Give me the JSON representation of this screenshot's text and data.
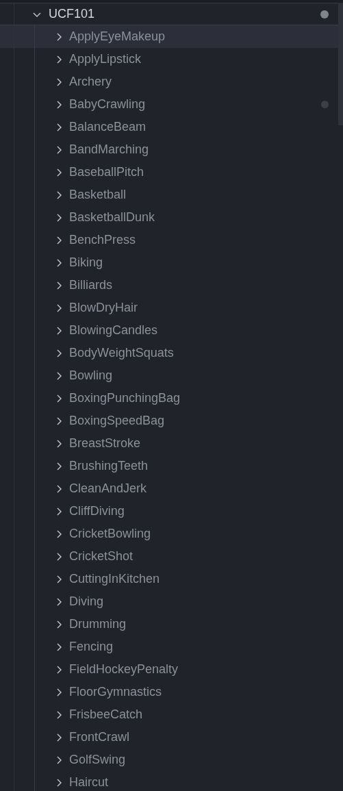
{
  "tree": {
    "label": "UCF101",
    "expanded": true,
    "modified": true,
    "children": [
      {
        "label": "ApplyEyeMakeup",
        "expanded": false,
        "hovered": true,
        "modified": false
      },
      {
        "label": "ApplyLipstick",
        "expanded": false,
        "hovered": false,
        "modified": false
      },
      {
        "label": "Archery",
        "expanded": false,
        "hovered": false,
        "modified": false
      },
      {
        "label": "BabyCrawling",
        "expanded": false,
        "hovered": false,
        "modified": true
      },
      {
        "label": "BalanceBeam",
        "expanded": false,
        "hovered": false,
        "modified": false
      },
      {
        "label": "BandMarching",
        "expanded": false,
        "hovered": false,
        "modified": false
      },
      {
        "label": "BaseballPitch",
        "expanded": false,
        "hovered": false,
        "modified": false
      },
      {
        "label": "Basketball",
        "expanded": false,
        "hovered": false,
        "modified": false
      },
      {
        "label": "BasketballDunk",
        "expanded": false,
        "hovered": false,
        "modified": false
      },
      {
        "label": "BenchPress",
        "expanded": false,
        "hovered": false,
        "modified": false
      },
      {
        "label": "Biking",
        "expanded": false,
        "hovered": false,
        "modified": false
      },
      {
        "label": "Billiards",
        "expanded": false,
        "hovered": false,
        "modified": false
      },
      {
        "label": "BlowDryHair",
        "expanded": false,
        "hovered": false,
        "modified": false
      },
      {
        "label": "BlowingCandles",
        "expanded": false,
        "hovered": false,
        "modified": false
      },
      {
        "label": "BodyWeightSquats",
        "expanded": false,
        "hovered": false,
        "modified": false
      },
      {
        "label": "Bowling",
        "expanded": false,
        "hovered": false,
        "modified": false
      },
      {
        "label": "BoxingPunchingBag",
        "expanded": false,
        "hovered": false,
        "modified": false
      },
      {
        "label": "BoxingSpeedBag",
        "expanded": false,
        "hovered": false,
        "modified": false
      },
      {
        "label": "BreastStroke",
        "expanded": false,
        "hovered": false,
        "modified": false
      },
      {
        "label": "BrushingTeeth",
        "expanded": false,
        "hovered": false,
        "modified": false
      },
      {
        "label": "CleanAndJerk",
        "expanded": false,
        "hovered": false,
        "modified": false
      },
      {
        "label": "CliffDiving",
        "expanded": false,
        "hovered": false,
        "modified": false
      },
      {
        "label": "CricketBowling",
        "expanded": false,
        "hovered": false,
        "modified": false
      },
      {
        "label": "CricketShot",
        "expanded": false,
        "hovered": false,
        "modified": false
      },
      {
        "label": "CuttingInKitchen",
        "expanded": false,
        "hovered": false,
        "modified": false
      },
      {
        "label": "Diving",
        "expanded": false,
        "hovered": false,
        "modified": false
      },
      {
        "label": "Drumming",
        "expanded": false,
        "hovered": false,
        "modified": false
      },
      {
        "label": "Fencing",
        "expanded": false,
        "hovered": false,
        "modified": false
      },
      {
        "label": "FieldHockeyPenalty",
        "expanded": false,
        "hovered": false,
        "modified": false
      },
      {
        "label": "FloorGymnastics",
        "expanded": false,
        "hovered": false,
        "modified": false
      },
      {
        "label": "FrisbeeCatch",
        "expanded": false,
        "hovered": false,
        "modified": false
      },
      {
        "label": "FrontCrawl",
        "expanded": false,
        "hovered": false,
        "modified": false
      },
      {
        "label": "GolfSwing",
        "expanded": false,
        "hovered": false,
        "modified": false
      },
      {
        "label": "Haircut",
        "expanded": false,
        "hovered": false,
        "modified": false
      }
    ]
  }
}
